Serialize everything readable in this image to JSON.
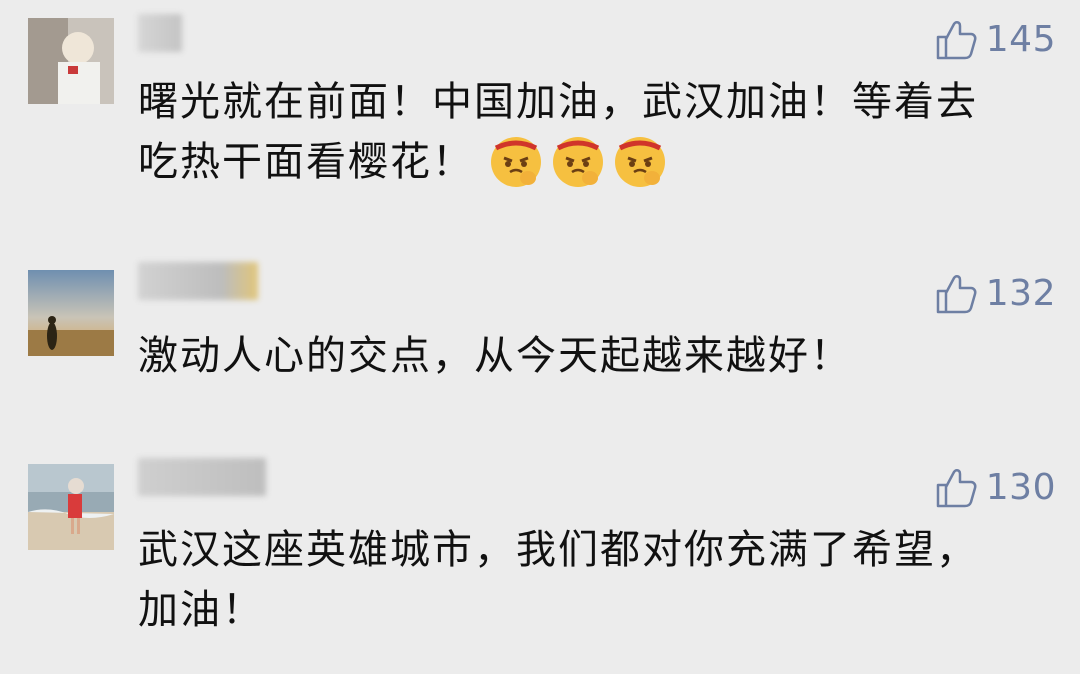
{
  "comments": [
    {
      "likes": "145",
      "text_line1": "曙光就在前面！中国加油，武汉加油！等着去",
      "text_line2": "吃热干面看樱花！",
      "emojis": [
        "angry-fist-emoji",
        "angry-fist-emoji",
        "angry-fist-emoji"
      ]
    },
    {
      "likes": "132",
      "text_line1": "激动人心的交点，从今天起越来越好！"
    },
    {
      "likes": "130",
      "text_line1": "武汉这座英雄城市，我们都对你充满了希望，",
      "text_line2": "加油！"
    }
  ],
  "colors": {
    "background": "#ececec",
    "like_color": "#6e7fa3",
    "text_color": "#111111"
  }
}
